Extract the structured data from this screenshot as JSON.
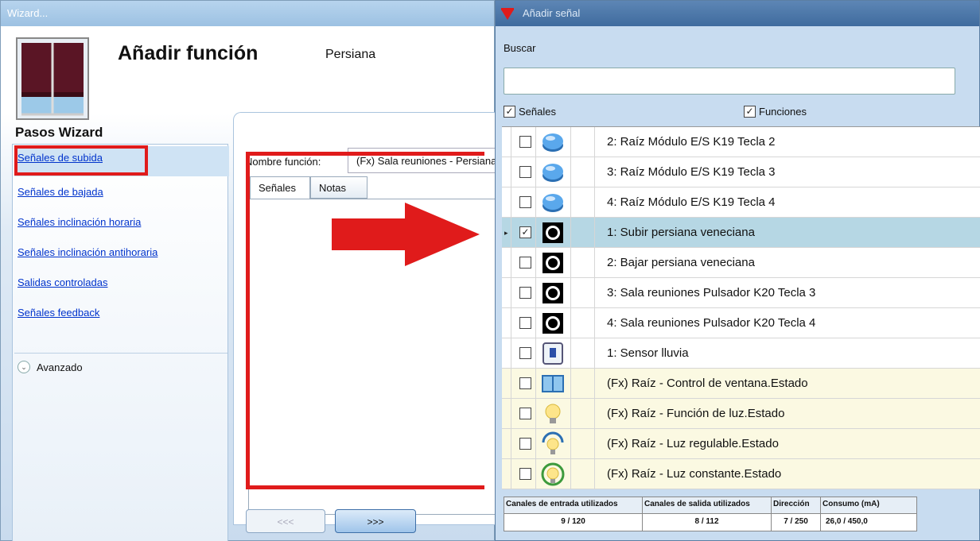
{
  "wizard": {
    "window_title": "Wizard...",
    "header_title": "Añadir función",
    "header_subtitle": "Persiana",
    "steps_title": "Pasos Wizard",
    "steps": [
      {
        "label": "Señales de subida"
      },
      {
        "label": "Señales de bajada"
      },
      {
        "label": "Señales inclinación horaria"
      },
      {
        "label": "Señales inclinación antihoraria"
      },
      {
        "label": "Salidas controladas"
      },
      {
        "label": "Señales feedback"
      }
    ],
    "advanced_label": "Avanzado",
    "function_name_label": "Nombre función:",
    "function_name_value": "(Fx) Sala reuniones - Persiana",
    "tabs": [
      {
        "label": "Señales"
      },
      {
        "label": "Notas"
      }
    ],
    "back_button": "<<<",
    "next_button": ">>>"
  },
  "dialog": {
    "title": "Añadir señal",
    "search_label": "Buscar",
    "search_value": "",
    "filter_signals": "Señales",
    "filter_functions": "Funciones",
    "rows": [
      {
        "label": "2: Raíz Módulo E/S K19 Tecla 2",
        "icon": "blue-button-icon",
        "checked": false
      },
      {
        "label": "3: Raíz Módulo E/S K19 Tecla 3",
        "icon": "blue-button-icon",
        "checked": false
      },
      {
        "label": "4: Raíz Módulo E/S K19 Tecla 4",
        "icon": "blue-button-icon",
        "checked": false
      },
      {
        "label": "1: Subir persiana veneciana",
        "icon": "pushbutton-icon",
        "checked": true
      },
      {
        "label": "2: Bajar persiana veneciana",
        "icon": "pushbutton-icon",
        "checked": false
      },
      {
        "label": "3: Sala reuniones Pulsador K20 Tecla 3",
        "icon": "pushbutton-icon",
        "checked": false
      },
      {
        "label": "4: Sala reuniones Pulsador K20 Tecla 4",
        "icon": "pushbutton-icon",
        "checked": false
      },
      {
        "label": "1: Sensor lluvia",
        "icon": "rain-sensor-icon",
        "checked": false
      },
      {
        "label": "(Fx) Raíz - Control de ventana.Estado",
        "icon": "window-icon",
        "checked": false
      },
      {
        "label": "(Fx) Raíz - Función de luz.Estado",
        "icon": "bulb-icon",
        "checked": false
      },
      {
        "label": "(Fx) Raíz - Luz regulable.Estado",
        "icon": "dimmable-bulb-icon",
        "checked": false
      },
      {
        "label": "(Fx) Raíz - Luz constante.Estado",
        "icon": "constant-light-icon",
        "checked": false
      }
    ],
    "stats": {
      "input_channels_label": "Canales de entrada utilizados",
      "output_channels_label": "Canales de salida utilizados",
      "address_label": "Dirección",
      "consumption_label": "Consumo (mA)",
      "input_channels_value": "9 / 120",
      "output_channels_value": "8 / 112",
      "address_value": "7 / 250",
      "consumption_value": "26,0 / 450,0"
    }
  },
  "colors": {
    "highlight_red": "#e01b1b",
    "selected_row": "#b6d7e4",
    "function_row": "#fbf9e2",
    "link_blue": "#0033cc"
  }
}
